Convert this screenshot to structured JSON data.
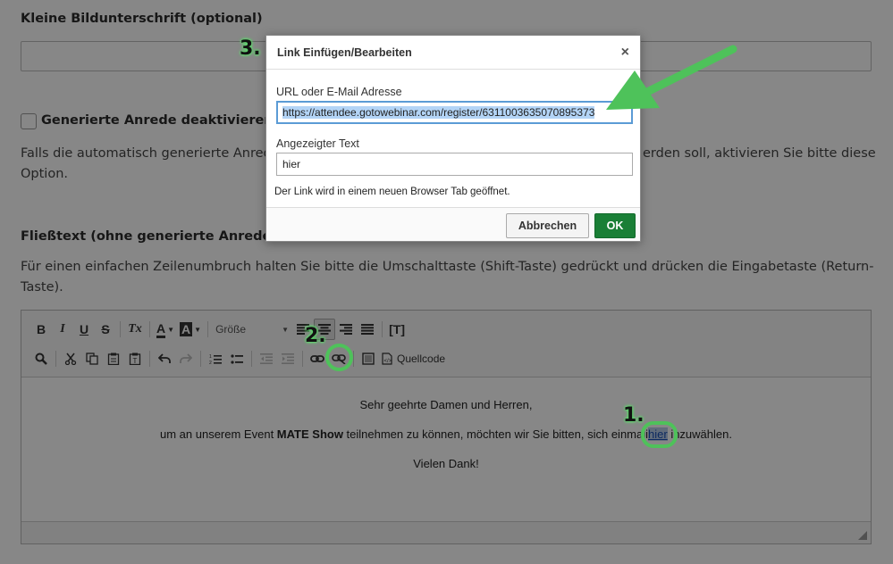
{
  "caption_section": {
    "label": "Kleine Bildunterschrift (optional)"
  },
  "salutation_section": {
    "checkbox_label": "Generierte Anrede deaktivieren",
    "help_line1_left": "Falls die automatisch generierte Anrede",
    "help_line1_right": "erden soll, aktivieren Sie bitte diese",
    "help_line2": "Option."
  },
  "body_section": {
    "label": "Fließtext (ohne generierte Anrede)",
    "help_line1": "Für einen einfachen Zeilenumbruch halten Sie bitte die Umschalttaste (Shift-Taste) gedrückt und drücken die Eingabetaste (Return-",
    "help_line2": "Taste)."
  },
  "editor": {
    "toolbar": {
      "bold": "B",
      "italic": "I",
      "underline": "U",
      "strike": "S",
      "remove_format": "Tx",
      "text_color": "A",
      "bg_color": "A",
      "font_size_placeholder": "Größe",
      "source_label": "Quellcode",
      "template": "[T]"
    },
    "content": {
      "greeting": "Sehr geehrte Damen und Herren,",
      "line_pre": "um an unserem Event ",
      "line_bold": "MATE Show",
      "line_mid": " teilnehmen zu können, möchten wir Sie bitten, sich einmali",
      "link_text": "hier",
      "line_post": " inzuwählen.",
      "thanks": "Vielen Dank!"
    }
  },
  "dialog": {
    "title": "Link Einfügen/Bearbeiten",
    "close": "×",
    "url_label": "URL oder E-Mail Adresse",
    "url_value": "https://attendee.gotowebinar.com/register/6311003635070895373",
    "text_label": "Angezeigter Text",
    "text_value": "hier",
    "note": "Der Link wird in einem neuen Browser Tab geöffnet.",
    "cancel": "Abbrechen",
    "ok": "OK"
  },
  "annotations": {
    "step1": "1.",
    "step2": "2.",
    "step3": "3."
  },
  "colors": {
    "accent_green": "#4ec25a",
    "ok_button": "#1a7f36",
    "overlay": "rgba(0,0,0,0.47)"
  }
}
